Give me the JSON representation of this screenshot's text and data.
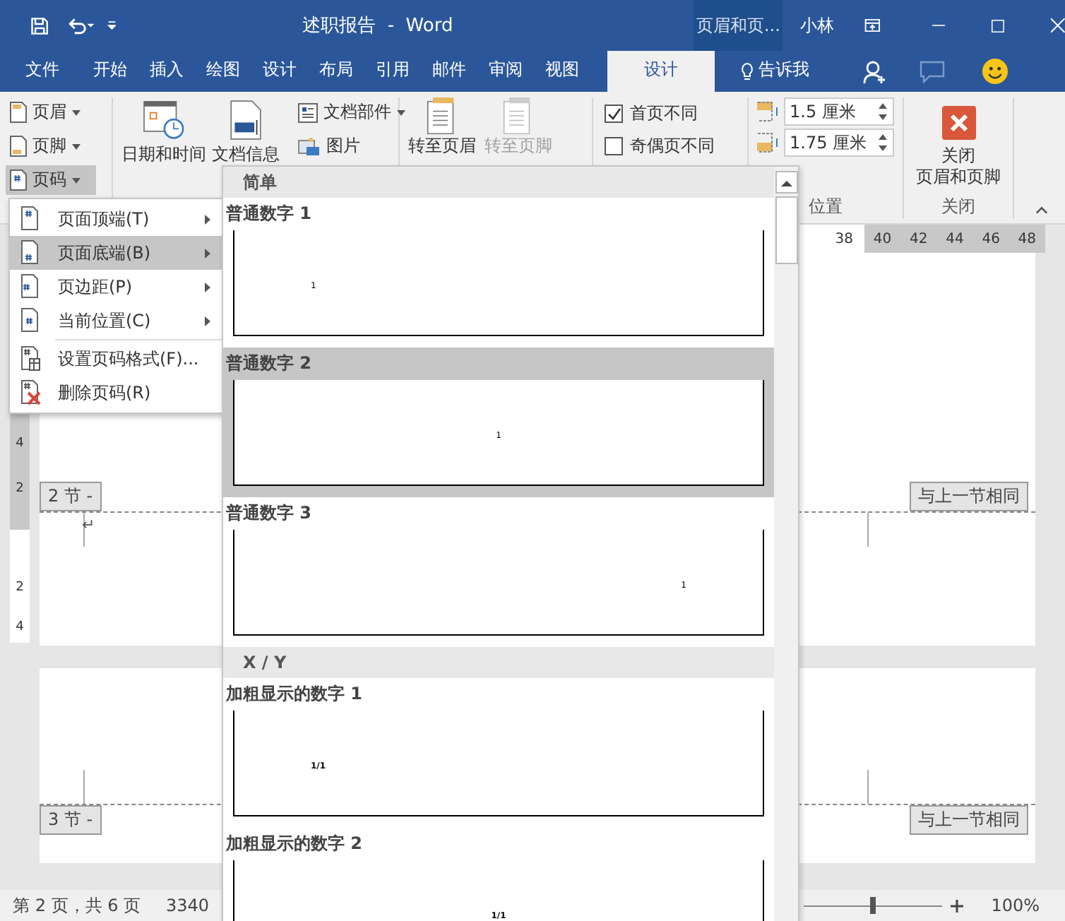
{
  "title_bar": {
    "title": "述职报告  -  Word",
    "context_tab": "页眉和页...",
    "user": "小林"
  },
  "ribbon_tabs": [
    {
      "label": "文件",
      "selected": false
    },
    {
      "label": "开始",
      "selected": false
    },
    {
      "label": "插入",
      "selected": false
    },
    {
      "label": "绘图",
      "selected": false
    },
    {
      "label": "设计",
      "selected": false
    },
    {
      "label": "布局",
      "selected": false
    },
    {
      "label": "引用",
      "selected": false
    },
    {
      "label": "邮件",
      "selected": false
    },
    {
      "label": "审阅",
      "selected": false
    },
    {
      "label": "视图",
      "selected": false
    },
    {
      "label": "设计",
      "selected": true
    }
  ],
  "tell_me": "告诉我",
  "ribbon": {
    "header_footer": [
      {
        "label": "页眉",
        "kind": "header",
        "selected": false
      },
      {
        "label": "页脚",
        "kind": "footer",
        "selected": false
      },
      {
        "label": "页码",
        "kind": "number",
        "selected": true
      }
    ],
    "insert_large": [
      {
        "label": "日期和时间",
        "kind": "calendar"
      },
      {
        "label": "文档信息",
        "kind": "document"
      }
    ],
    "insert_small": [
      {
        "label": "文档部件",
        "kind": "parts",
        "dropdown": true
      },
      {
        "label": "图片",
        "kind": "picture",
        "dropdown": false
      }
    ],
    "navigation": [
      {
        "label": "转至页眉",
        "disabled": false
      },
      {
        "label": "转至页脚",
        "disabled": true
      }
    ],
    "options": [
      {
        "label": "首页不同",
        "checked": true
      },
      {
        "label": "奇偶页不同",
        "checked": false
      }
    ],
    "position": {
      "fields": [
        "1.5 厘米",
        "1.75 厘米"
      ],
      "group_label": "位置"
    },
    "close": {
      "button_lines": [
        "关闭",
        "页眉和页脚"
      ],
      "group_label": "关闭"
    }
  },
  "ruler_numbers": [
    "38",
    "40",
    "42",
    "44",
    "46",
    "48"
  ],
  "vertical_ruler_numbers": [
    "4",
    "2",
    "2",
    "4"
  ],
  "document": {
    "sections": [
      {
        "kind": "footer",
        "label": "2 节 -",
        "same_as_previous": "与上一节相同",
        "paragraph_mark": "↵"
      },
      {
        "kind": "header",
        "label": "3 节 -",
        "same_as_previous": "与上一节相同"
      }
    ]
  },
  "page_number_menu": [
    {
      "label": "页面顶端(T)",
      "kind": "top",
      "submenu": true,
      "selected": false
    },
    {
      "label": "页面底端(B)",
      "kind": "bottom",
      "submenu": true,
      "selected": true
    },
    {
      "label": "页边距(P)",
      "kind": "margin",
      "submenu": true,
      "selected": false
    },
    {
      "label": "当前位置(C)",
      "kind": "current",
      "submenu": true,
      "selected": false
    },
    {
      "label": "设置页码格式(F)...",
      "kind": "format",
      "submenu": false,
      "selected": false
    },
    {
      "label": "删除页码(R)",
      "kind": "remove",
      "submenu": false,
      "selected": false
    }
  ],
  "gallery": {
    "groups": [
      {
        "heading": "简单",
        "items": [
          {
            "label": "普通数字 1",
            "selected": false,
            "kind": "left",
            "sample": "1"
          },
          {
            "label": "普通数字 2",
            "selected": true,
            "kind": "center",
            "sample": "1"
          },
          {
            "label": "普通数字 3",
            "selected": false,
            "kind": "right",
            "sample": "1"
          }
        ]
      },
      {
        "heading": "X / Y",
        "items": [
          {
            "label": "加粗显示的数字 1",
            "selected": false,
            "kind": "left",
            "sample": "1/1"
          },
          {
            "label": "加粗显示的数字 2",
            "selected": false,
            "kind": "center",
            "sample": "1/1"
          }
        ]
      }
    ]
  },
  "status_bar": {
    "page": "第 2 页，共 6 页",
    "words": "3340",
    "zoom_slider": {
      "level": 0.5
    },
    "zoom": "100%"
  }
}
